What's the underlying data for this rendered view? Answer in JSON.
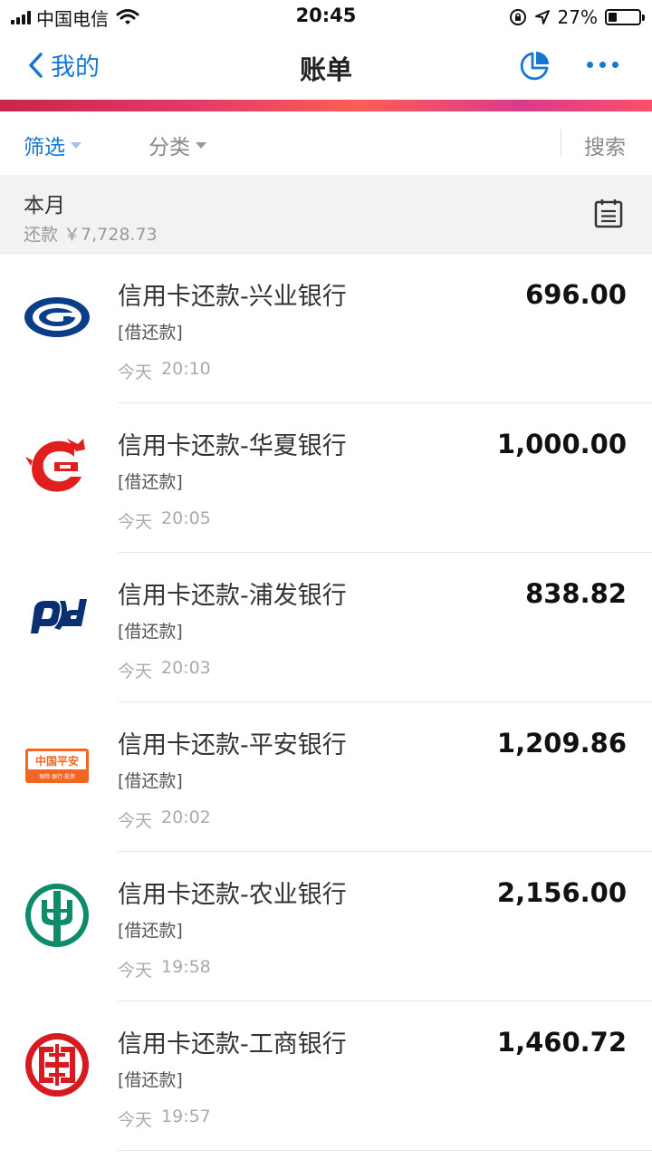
{
  "status_bar": {
    "carrier": "中国电信",
    "time": "20:45",
    "battery_percent": "27%",
    "battery_level": 0.27,
    "icons": [
      "signal-icon",
      "wifi-icon",
      "rotation-lock-icon",
      "location-icon",
      "battery-icon"
    ]
  },
  "nav": {
    "back_label": "我的",
    "title": "账单",
    "icons": [
      "chevron-left-icon",
      "pie-chart-icon",
      "more-icon"
    ],
    "accent_color": "#1677d2"
  },
  "filters": {
    "filter_label": "筛选",
    "category_label": "分类",
    "search_label": "搜索"
  },
  "month": {
    "label": "本月",
    "summary_label": "还款",
    "summary_amount": "￥7,728.73",
    "icon": "calendar-icon"
  },
  "transactions": [
    {
      "name": "信用卡还款-兴业银行",
      "tag": "[借还款]",
      "day": "今天",
      "time": "20:10",
      "amount": "696.00",
      "logo": "cib-bank-logo"
    },
    {
      "name": "信用卡还款-华夏银行",
      "tag": "[借还款]",
      "day": "今天",
      "time": "20:05",
      "amount": "1,000.00",
      "logo": "hua-xia-bank-logo"
    },
    {
      "name": "信用卡还款-浦发银行",
      "tag": "[借还款]",
      "day": "今天",
      "time": "20:03",
      "amount": "838.82",
      "logo": "spd-bank-logo"
    },
    {
      "name": "信用卡还款-平安银行",
      "tag": "[借还款]",
      "day": "今天",
      "time": "20:02",
      "amount": "1,209.86",
      "logo": "ping-an-bank-logo",
      "logo_text": "中国平安",
      "logo_subtext": "保险·银行·投资"
    },
    {
      "name": "信用卡还款-农业银行",
      "tag": "[借还款]",
      "day": "今天",
      "time": "19:58",
      "amount": "2,156.00",
      "logo": "abc-bank-logo"
    },
    {
      "name": "信用卡还款-工商银行",
      "tag": "[借还款]",
      "day": "今天",
      "time": "19:57",
      "amount": "1,460.72",
      "logo": "icbc-bank-logo"
    }
  ]
}
